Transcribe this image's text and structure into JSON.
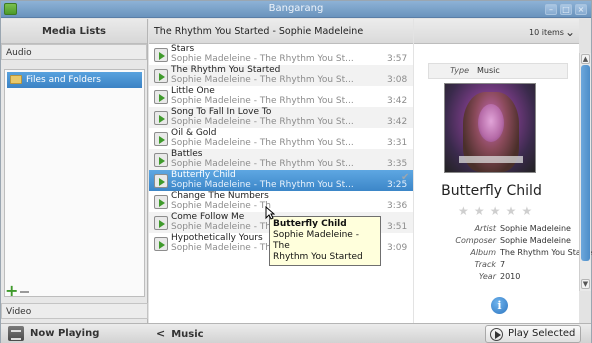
{
  "window": {
    "title": "Bangarang"
  },
  "left_pane": {
    "header": "Media Lists",
    "categories": {
      "audio": "Audio",
      "video": "Video"
    },
    "tree_items": [
      "Files and Folders"
    ]
  },
  "center_pane": {
    "header": "The Rhythm You Started - Sophie Madeleine",
    "item_count": "10 items",
    "tracks": [
      {
        "title": "Stars",
        "subtitle": "Sophie Madeleine - The Rhythm You St...",
        "duration": "3:57"
      },
      {
        "title": "The Rhythm You Started",
        "subtitle": "Sophie Madeleine - The Rhythm You St...",
        "duration": "3:08"
      },
      {
        "title": "Little One",
        "subtitle": "Sophie Madeleine - The Rhythm You St...",
        "duration": "3:42"
      },
      {
        "title": "Song To Fall In Love To",
        "subtitle": "Sophie Madeleine - The Rhythm You St...",
        "duration": "3:42"
      },
      {
        "title": "Oil & Gold",
        "subtitle": "Sophie Madeleine - The Rhythm You St...",
        "duration": "3:31"
      },
      {
        "title": "Battles",
        "subtitle": "Sophie Madeleine - The Rhythm You St...",
        "duration": "3:35"
      },
      {
        "title": "Butterfly Child",
        "subtitle": "Sophie Madeleine - The Rhythm You St...",
        "duration": "3:25",
        "selected": true
      },
      {
        "title": "Change The Numbers",
        "subtitle": "Sophie Madeleine - Th",
        "duration": "3:36"
      },
      {
        "title": "Come Follow Me",
        "subtitle": "Sophie Madeleine - Th",
        "duration": "3:51"
      },
      {
        "title": "Hypothetically Yours",
        "subtitle": "Sophie Madeleine - The Rhythm You St...",
        "duration": "3:09"
      }
    ],
    "tooltip": {
      "title": "Butterfly Child",
      "line2": "Sophie Madeleine - The",
      "line3": "Rhythm You Started"
    }
  },
  "right_pane": {
    "type_label": "Type",
    "type_value": "Music",
    "song_title": "Butterfly Child",
    "rating_stars": 0,
    "metadata": [
      {
        "key": "Artist",
        "value": "Sophie Madeleine"
      },
      {
        "key": "Composer",
        "value": "Sophie Madeleine"
      },
      {
        "key": "Album",
        "value": "The Rhythm You Started"
      },
      {
        "key": "Track",
        "value": "7"
      },
      {
        "key": "Year",
        "value": "2010"
      }
    ]
  },
  "bottom_bar": {
    "now_playing": "Now Playing",
    "back_label": "Music",
    "play_selected": "Play Selected"
  },
  "icons": {
    "app": "app-icon",
    "folder": "folder-icon",
    "audio_file": "audio-file-icon",
    "info": "info-icon",
    "add": "plus-icon",
    "remove": "minus-icon",
    "play": "play-circle-icon"
  },
  "colors": {
    "selection": "#3c86c8",
    "titlebar": "#7aa2ca",
    "accent": "#2f76c0"
  }
}
